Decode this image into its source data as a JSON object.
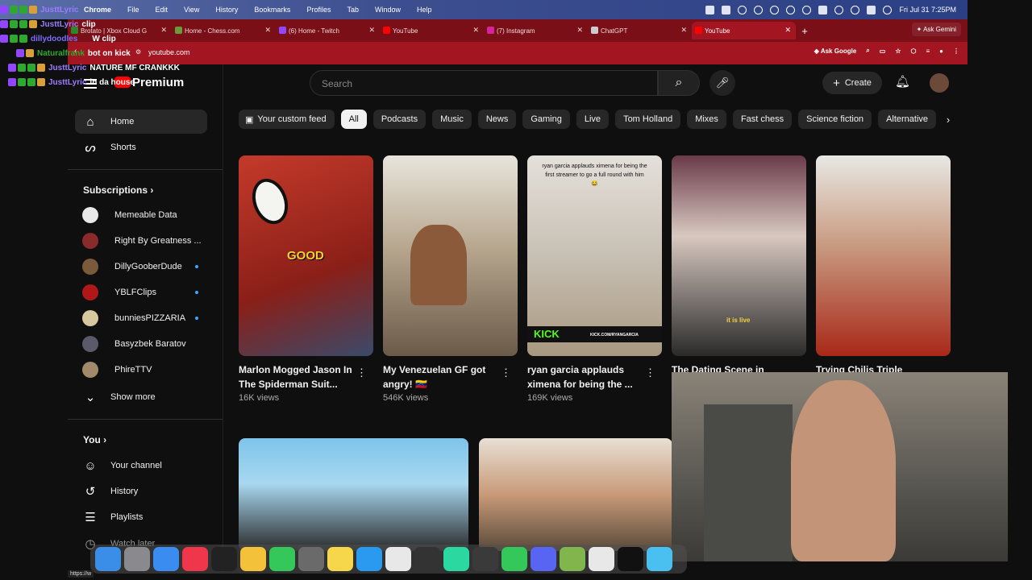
{
  "menubar": {
    "app_name": "Chrome",
    "menu_items": [
      "File",
      "Edit",
      "View",
      "History",
      "Bookmarks",
      "Profiles",
      "Tab",
      "Window",
      "Help"
    ],
    "clock": "Fri Jul 31  7:25PM"
  },
  "tabs": [
    {
      "label": "Brotato | Xbox Cloud G",
      "favicon_color": "#2a8a2a",
      "active": false
    },
    {
      "label": "Home - Chess.com",
      "favicon_color": "#6a9a3a",
      "active": false
    },
    {
      "label": "(6) Home - Twitch",
      "favicon_color": "#9146ff",
      "active": false
    },
    {
      "label": "YouTube",
      "favicon_color": "#ff0000",
      "active": false
    },
    {
      "label": "(7) Instagram",
      "favicon_color": "#d6249f",
      "active": false
    },
    {
      "label": "ChatGPT",
      "favicon_color": "#cccccc",
      "active": false
    },
    {
      "label": "YouTube",
      "favicon_color": "#ff0000",
      "active": true
    }
  ],
  "ask_gemini": "Ask Gemini",
  "address": {
    "url": "youtube.com",
    "ask_google": "Ask Google"
  },
  "youtube": {
    "logo_text": "Premium",
    "search_placeholder": "Search",
    "create_label": "Create",
    "nav": [
      {
        "label": "Home",
        "icon": "home-icon",
        "selected": true
      },
      {
        "label": "Shorts",
        "icon": "shorts-icon",
        "selected": false
      }
    ],
    "subscriptions_heading": "Subscriptions",
    "subscriptions": [
      {
        "name": "Memeable Data",
        "avatar_color": "#e8e8e8",
        "new": false
      },
      {
        "name": "Right By Greatness ...",
        "avatar_color": "#8a2a2a",
        "new": false
      },
      {
        "name": "DillyGooberDude",
        "avatar_color": "#7a5a3a",
        "new": true
      },
      {
        "name": "YBLFClips",
        "avatar_color": "#b01818",
        "new": true
      },
      {
        "name": "bunniesPIZZARIA",
        "avatar_color": "#d8c8a0",
        "new": true
      },
      {
        "name": "Basyzbek Baratov",
        "avatar_color": "#5a5a6a",
        "new": false
      },
      {
        "name": "PhireTTV",
        "avatar_color": "#a08a6a",
        "new": false
      }
    ],
    "show_more": "Show more",
    "you_heading": "You",
    "you_items": [
      {
        "label": "Your channel",
        "icon": "channel-icon"
      },
      {
        "label": "History",
        "icon": "history-icon"
      },
      {
        "label": "Playlists",
        "icon": "playlists-icon"
      },
      {
        "label": "Watch later",
        "icon": "watch-later-icon"
      }
    ],
    "chips": [
      "Your custom feed",
      "All",
      "Podcasts",
      "Music",
      "News",
      "Gaming",
      "Live",
      "Tom Holland",
      "Mixes",
      "Fast chess",
      "Science fiction",
      "Alternative"
    ],
    "selected_chip": "All",
    "shorts": [
      {
        "title": "Marlon Mogged Jason In The Spiderman Suit...",
        "views": "16K views",
        "overlay": "GOOD",
        "bg": "linear-gradient(160deg,#c43a2a,#8a1f18 60%,#3a4a6a)"
      },
      {
        "title": "My Venezuelan GF got angry! 🇻🇪",
        "views": "546K views",
        "overlay": "",
        "bg": "linear-gradient(180deg,#e8e4dc,#b8a890 45%,#6a5a48)"
      },
      {
        "title": "ryan garcia applauds ximena for being the ...",
        "views": "169K views",
        "overlay": "ryan garcia applauds ximena for being the first streamer to go a full round with him 😂",
        "bg": "linear-gradient(180deg,#e4e0da,#c8c0b4 50%,#a89880)"
      },
      {
        "title": "The Dating Scene in",
        "views": "",
        "overlay": "it is live",
        "bg": "linear-gradient(180deg,#6a3a4a,#d8c8c0 40%,#2a2a2a)"
      },
      {
        "title": "Trying Chilis Triple",
        "views": "",
        "overlay": "",
        "bg": "linear-gradient(180deg,#e8e8e4,#c89a80 45%,#a82818)"
      }
    ],
    "kick_label": "KICK",
    "kick_url": "KICK.COM/RYANGARCIA"
  },
  "chat_overlay": [
    {
      "user": "JusttLyric",
      "message": "",
      "user_color": "#9c7cff"
    },
    {
      "user": "JusttLyric",
      "message": "clip",
      "user_color": "#9c7cff"
    },
    {
      "user": "dillydoodles",
      "message": "W clip",
      "user_color": "#7a6cff"
    },
    {
      "user": "Naturalfrank",
      "message": "bot on kick",
      "user_color": "#2ea82e"
    },
    {
      "user": "JusttLyric",
      "message": "NATURE MF CRANKKK",
      "user_color": "#9c7cff"
    },
    {
      "user": "JusttLyric",
      "message": "in da house",
      "user_color": "#9c7cff"
    }
  ],
  "status_url": "https://w"
}
